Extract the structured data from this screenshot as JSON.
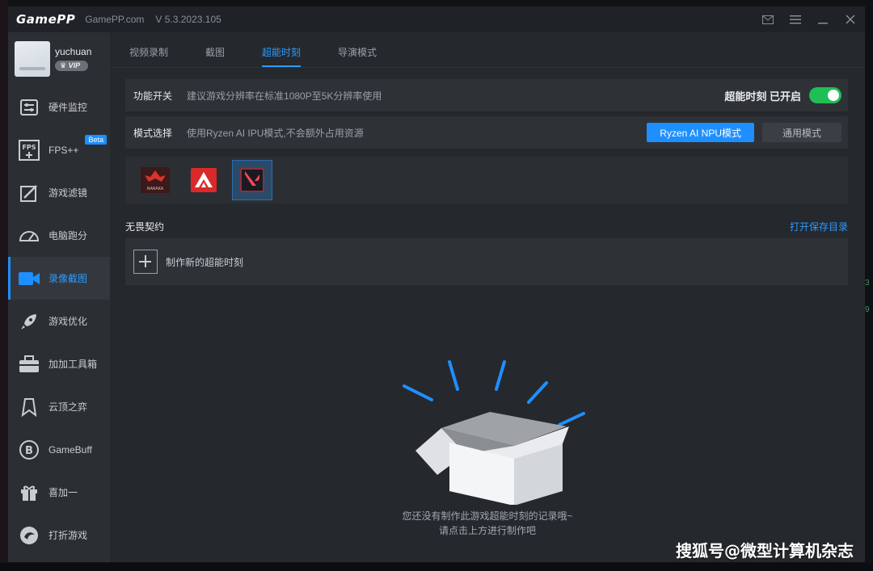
{
  "titlebar": {
    "logo": "GamePP",
    "site": "GamePP.com",
    "version": "V 5.3.2023.105"
  },
  "user": {
    "name": "yuchuan",
    "badge": "VIP"
  },
  "sidebar": {
    "items": [
      {
        "label": "硬件监控",
        "icon": "hardware-monitor-icon"
      },
      {
        "label": "FPS++",
        "icon": "fps-icon",
        "badge": "Beta"
      },
      {
        "label": "游戏滤镜",
        "icon": "game-filter-icon"
      },
      {
        "label": "电脑跑分",
        "icon": "benchmark-gauge-icon"
      },
      {
        "label": "录像截图",
        "icon": "video-camera-icon",
        "active": true
      },
      {
        "label": "游戏优化",
        "icon": "rocket-icon"
      },
      {
        "label": "加加工具箱",
        "icon": "toolbox-icon"
      },
      {
        "label": "云顶之弈",
        "icon": "tft-icon"
      },
      {
        "label": "GameBuff",
        "icon": "gamebuff-icon"
      },
      {
        "label": "喜加一",
        "icon": "gift-icon"
      },
      {
        "label": "打折游戏",
        "icon": "discount-game-icon"
      }
    ]
  },
  "tabs": [
    {
      "label": "视频录制"
    },
    {
      "label": "截图"
    },
    {
      "label": "超能时刻",
      "active": true
    },
    {
      "label": "导演模式"
    }
  ],
  "feature": {
    "title": "功能开关",
    "desc": "建议游戏分辨率在标准1080P至5K分辨率使用",
    "status": "超能时刻 已开启",
    "enabled": true
  },
  "mode": {
    "title": "模式选择",
    "desc": "使用Ryzen AI IPU模式,不会额外占用资源",
    "primary": "Ryzen AI NPU模式",
    "secondary": "通用模式"
  },
  "games": [
    {
      "name": "naraka-game-icon",
      "label": "NARAKA"
    },
    {
      "name": "apex-game-icon"
    },
    {
      "name": "valorant-game-icon",
      "selected": true
    }
  ],
  "section": {
    "title": "无畏契约",
    "open_dir": "打开保存目录",
    "create_label": "制作新的超能时刻"
  },
  "empty": {
    "line1": "您还没有制作此游戏超能时刻的记录哦~",
    "line2": "请点击上方进行制作吧"
  },
  "watermark": "搜狐号@微型计算机杂志",
  "colors": {
    "accent": "#1e8fff",
    "toggle_on": "#1fbf55",
    "bg_main": "#25282d",
    "bg_sidebar": "#2b2e33"
  }
}
